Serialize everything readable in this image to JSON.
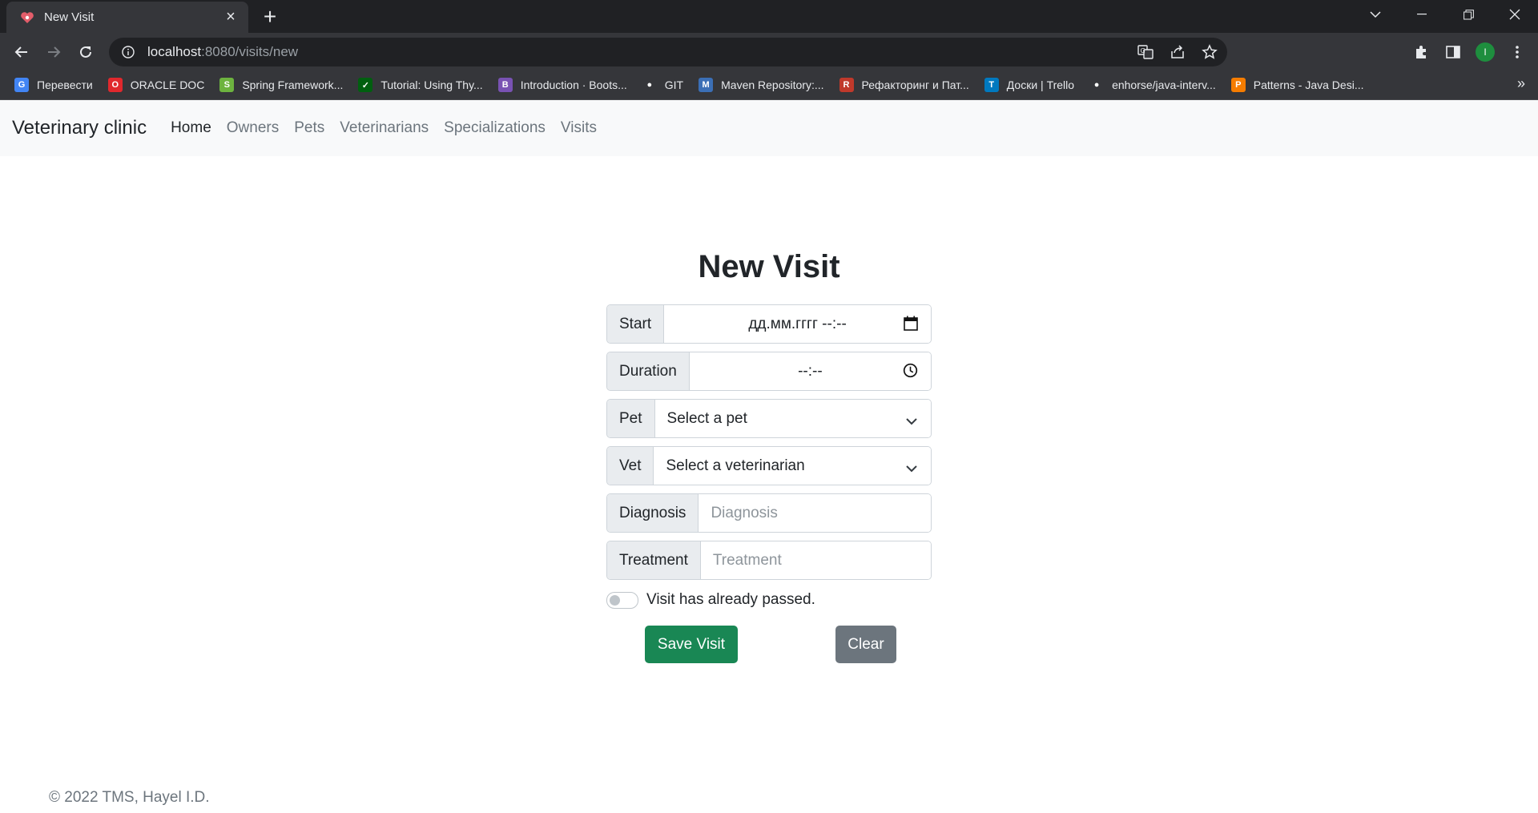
{
  "browser": {
    "tab_title": "New Visit",
    "url_host": "localhost",
    "url_path": ":8080/visits/new",
    "profile_initial": "I",
    "bookmarks": [
      {
        "label": "Перевести",
        "icon": "google-translate-icon",
        "color": "#4285f4",
        "glyph": "G"
      },
      {
        "label": "ORACLE DOC",
        "icon": "oracle-icon",
        "color": "#e0282d",
        "glyph": "O"
      },
      {
        "label": "Spring Framework...",
        "icon": "spring-leaf-icon",
        "color": "#6db33f",
        "glyph": "S"
      },
      {
        "label": "Tutorial: Using Thy...",
        "icon": "thymeleaf-icon",
        "color": "#005f0f",
        "glyph": "✓"
      },
      {
        "label": "Introduction · Boots...",
        "icon": "bootstrap-icon",
        "color": "#7952b3",
        "glyph": "B"
      },
      {
        "label": "GIT",
        "icon": "github-icon",
        "color": "#35363a",
        "glyph": "●"
      },
      {
        "label": "Maven Repository:...",
        "icon": "maven-icon",
        "color": "#3b6fb6",
        "glyph": "M"
      },
      {
        "label": "Рефакторинг и Пат...",
        "icon": "refactoring-guru-icon",
        "color": "#c0392b",
        "glyph": "R"
      },
      {
        "label": "Доски | Trello",
        "icon": "trello-icon",
        "color": "#0079bf",
        "glyph": "T"
      },
      {
        "label": "enhorse/java-interv...",
        "icon": "github-icon",
        "color": "#35363a",
        "glyph": "●"
      },
      {
        "label": "Patterns - Java Desi...",
        "icon": "patterns-icon",
        "color": "#f57c00",
        "glyph": "P"
      }
    ]
  },
  "navbar": {
    "brand": "Veterinary clinic",
    "links": [
      "Home",
      "Owners",
      "Pets",
      "Veterinarians",
      "Specializations",
      "Visits"
    ]
  },
  "form": {
    "title": "New Visit",
    "start_label": "Start",
    "start_value": "дд.мм.гггг --:--",
    "duration_label": "Duration",
    "duration_value": "--:--",
    "pet_label": "Pet",
    "pet_value": "Select a pet",
    "vet_label": "Vet",
    "vet_value": "Select a veterinarian",
    "diagnosis_label": "Diagnosis",
    "diagnosis_placeholder": "Diagnosis",
    "treatment_label": "Treatment",
    "treatment_placeholder": "Treatment",
    "passed_label": "Visit has already passed.",
    "save_label": "Save Visit",
    "clear_label": "Clear"
  },
  "footer": {
    "text": "© 2022 TMS, Hayel I.D."
  }
}
